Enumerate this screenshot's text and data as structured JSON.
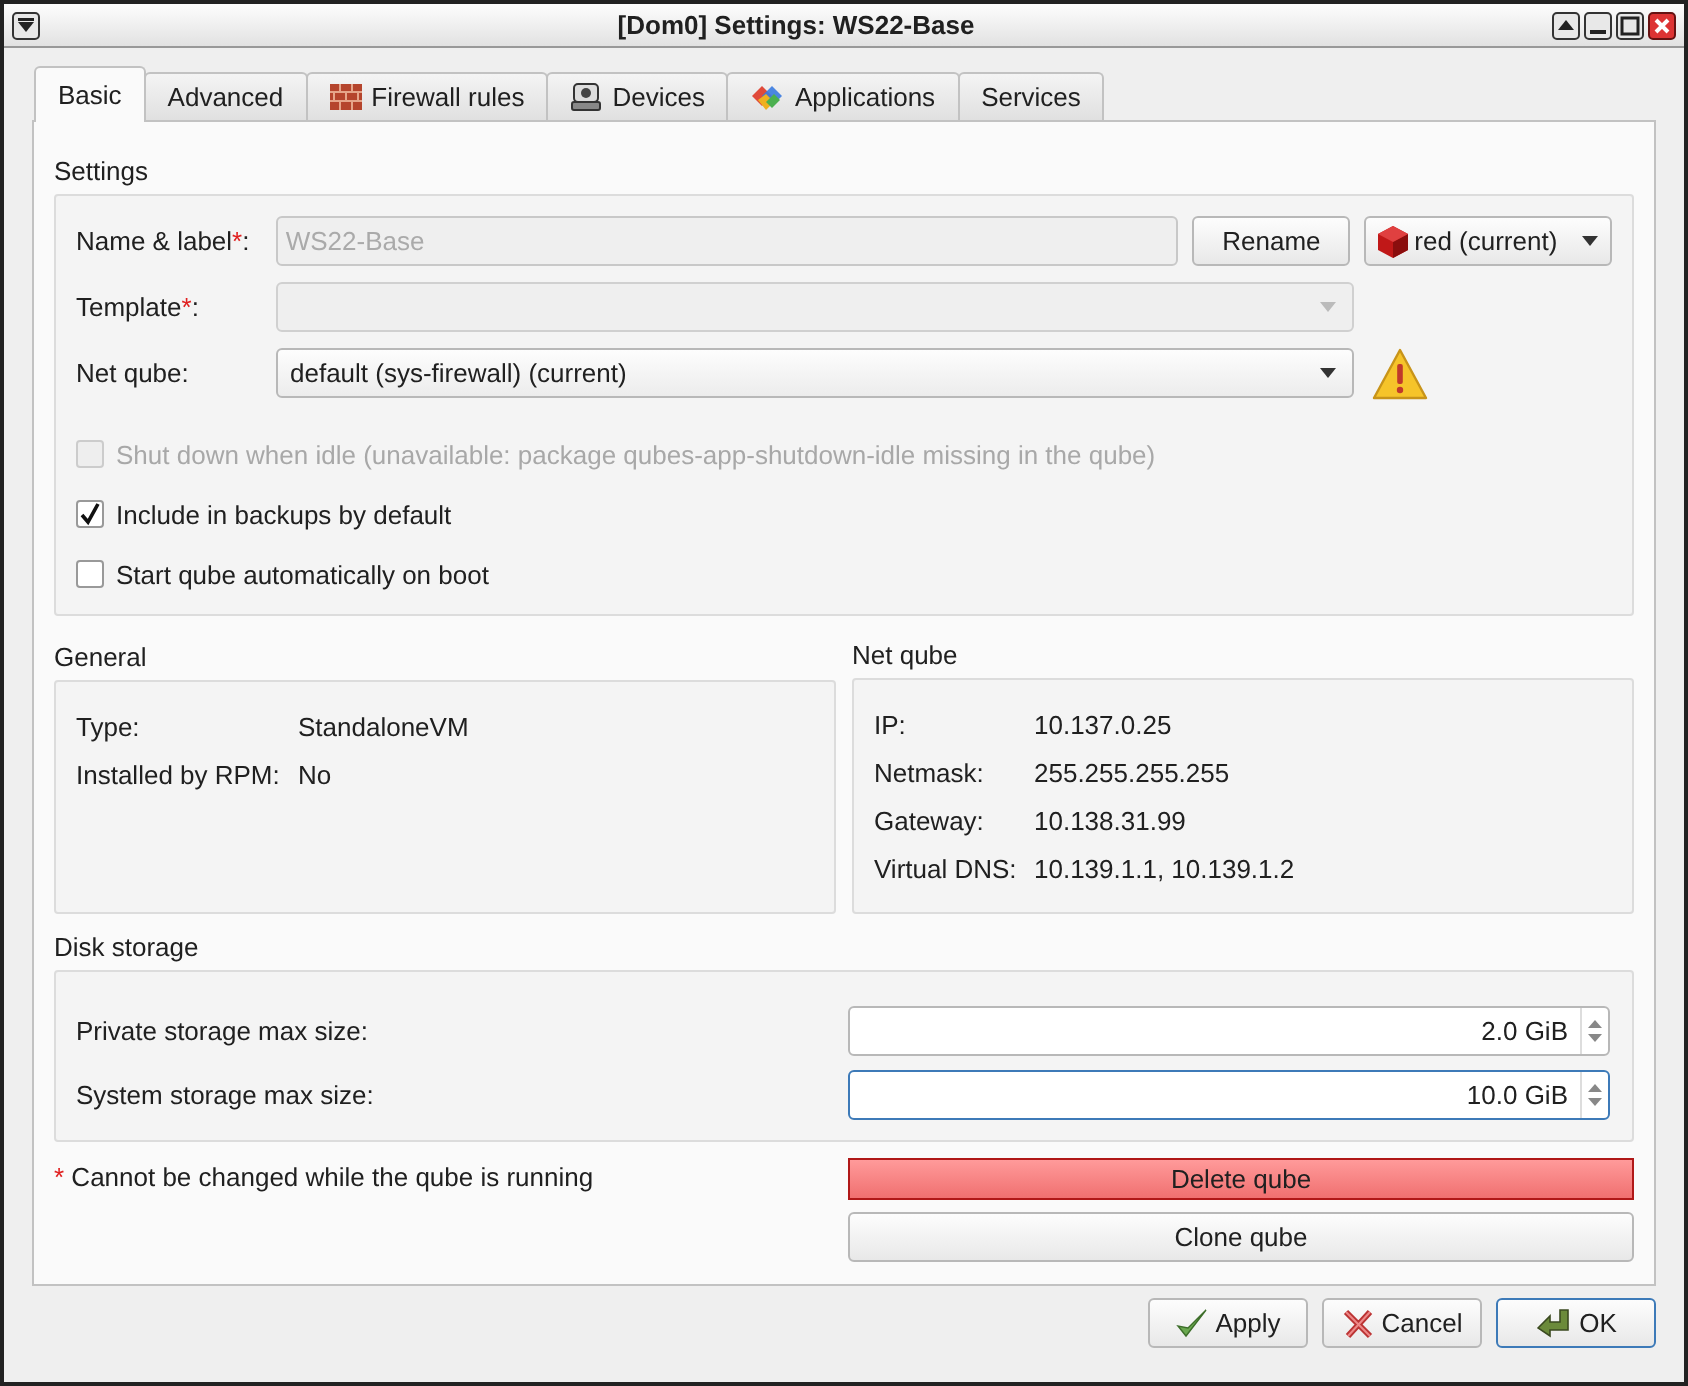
{
  "window": {
    "title": "[Dom0] Settings: WS22-Base"
  },
  "tabs": [
    {
      "label": "Basic",
      "kind": "plain",
      "selected": true
    },
    {
      "label": "Advanced",
      "kind": "plain",
      "selected": false
    },
    {
      "label": "Firewall rules",
      "kind": "firewall",
      "selected": false
    },
    {
      "label": "Devices",
      "kind": "devices",
      "selected": false
    },
    {
      "label": "Applications",
      "kind": "applications",
      "selected": false
    },
    {
      "label": "Services",
      "kind": "plain",
      "selected": false
    }
  ],
  "settings": {
    "heading": "Settings",
    "name": {
      "label": "Name & label",
      "required_mark": "*",
      "label_end": ":",
      "value": "WS22-Base",
      "disabled": true
    },
    "rename_button": "Rename",
    "label_select": {
      "value": "red (current)"
    },
    "template": {
      "label": "Template",
      "required_mark": "*",
      "label_end": ":",
      "disabled": true
    },
    "net_qube": {
      "label": "Net qube:",
      "value": "default (sys-firewall) (current)",
      "warning": true
    },
    "checkboxes": [
      {
        "label": "Shut down when idle (unavailable: package qubes-app-shutdown-idle missing in the qube)",
        "checked": false,
        "disabled": true
      },
      {
        "label": "Include in backups by default",
        "checked": true,
        "disabled": false
      },
      {
        "label": "Start qube automatically on boot",
        "checked": false,
        "disabled": false
      }
    ]
  },
  "general": {
    "heading": "General",
    "rows": [
      {
        "key": "Type:",
        "value": "StandaloneVM"
      },
      {
        "key": "Installed by RPM:",
        "value": "No"
      }
    ]
  },
  "net_info": {
    "heading": "Net qube",
    "rows": [
      {
        "key": "IP:",
        "value": "10.137.0.25"
      },
      {
        "key": "Netmask:",
        "value": "255.255.255.255"
      },
      {
        "key": "Gateway:",
        "value": "10.138.31.99"
      },
      {
        "key": "Virtual DNS:",
        "value": "10.139.1.1, 10.139.1.2"
      }
    ]
  },
  "disk": {
    "heading": "Disk storage",
    "rows": [
      {
        "label": "Private storage max size:",
        "value": "2.0 GiB",
        "focused": false
      },
      {
        "label": "System storage max size:",
        "value": "10.0 GiB",
        "focused": true
      }
    ]
  },
  "note": {
    "mark": "*",
    "text": "Cannot be changed while the qube is running"
  },
  "delete_button": "Delete qube",
  "clone_button": "Clone qube",
  "buttons": [
    {
      "kind": "apply",
      "label": "Apply"
    },
    {
      "kind": "cancel",
      "label": "Cancel"
    },
    {
      "kind": "ok",
      "label": "OK"
    }
  ]
}
